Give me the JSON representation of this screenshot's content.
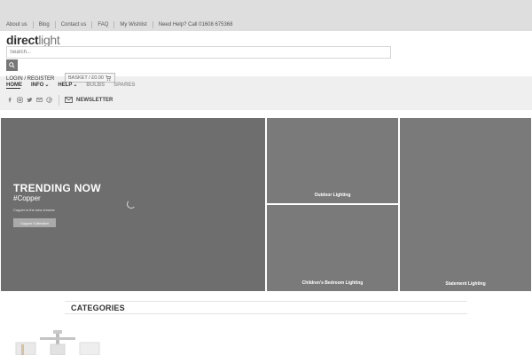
{
  "topbar": {
    "links": [
      "About us",
      "Blog",
      "Contact us",
      "FAQ",
      "My Wishlist"
    ],
    "help": "Need Help? Call 01608 675368"
  },
  "logo": {
    "part1": "direct",
    "part2": "light"
  },
  "search": {
    "placeholder": "Search..."
  },
  "account": {
    "login": "LOGIN / REGISTER",
    "basket": "BASKET / £0.00"
  },
  "menu": {
    "items": [
      "HOME",
      "INFO",
      "HELP",
      "BULBS",
      "SPARES"
    ]
  },
  "newsletter": "NEWSLETTER",
  "hero": {
    "title": "TRENDING NOW",
    "tag": "#Copper",
    "sub": "Copper is the new chrome",
    "button": "Copper Collection"
  },
  "tiles": [
    "Outdoor Lighting",
    "Children's Bedroom Lighting",
    "Statement Lighting"
  ],
  "categories": {
    "title": "CATEGORIES"
  },
  "colors": {
    "topbar": "#dedede",
    "hero": "#6e6e6e",
    "tile": "#7a7a7a"
  },
  "icons": [
    "search-icon",
    "cart-icon",
    "facebook-icon",
    "instagram-icon",
    "twitter-icon",
    "email-icon",
    "pinterest-icon",
    "envelope-icon"
  ]
}
